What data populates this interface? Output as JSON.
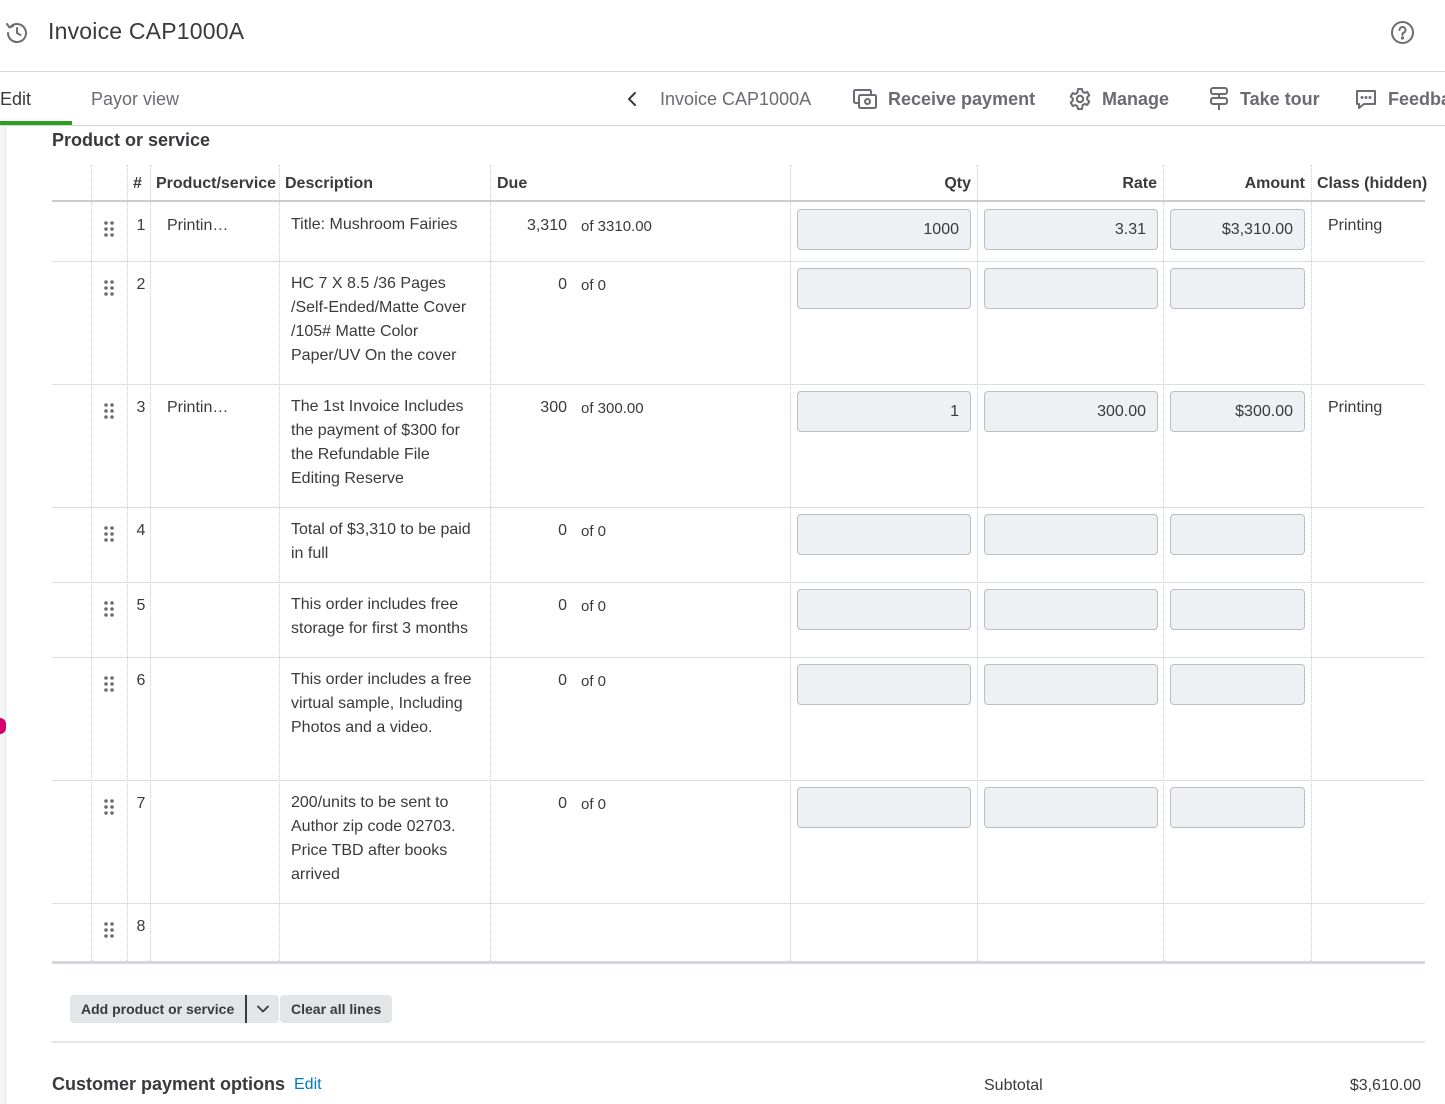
{
  "header": {
    "title": "Invoice CAP1000A",
    "history_icon": "history-icon",
    "help_icon": "help-icon"
  },
  "tabs": [
    {
      "label": "Edit",
      "active": true
    },
    {
      "label": "Payor view",
      "active": false
    }
  ],
  "nav": {
    "back_icon": "chevron-left-icon",
    "title": "Invoice CAP1000A"
  },
  "actions": [
    {
      "label": "Receive payment",
      "icon": "receive-payment-icon"
    },
    {
      "label": "Manage",
      "icon": "gear-icon"
    },
    {
      "label": "Take tour",
      "icon": "tour-icon"
    },
    {
      "label": "Feedback",
      "icon": "feedback-icon"
    }
  ],
  "section": {
    "title": "Product or service"
  },
  "table": {
    "columns": [
      "#",
      "Product/service",
      "Description",
      "Due",
      "Qty",
      "Rate",
      "Amount",
      "Class (hidden)"
    ],
    "rows": [
      {
        "num": "1",
        "product": "Printin…",
        "description": "Title: Mushroom Fairies",
        "due": "3,310",
        "due_of": "of 3310.00",
        "qty": "1000",
        "rate": "3.31",
        "amount": "$3,310.00",
        "class": "Printing"
      },
      {
        "num": "2",
        "product": "",
        "description": "HC 7 X 8.5 /36 Pages /Self-Ended/Matte Cover /105#  Matte Color Paper/UV On the cover",
        "due": "0",
        "due_of": "of 0",
        "qty": "",
        "rate": "",
        "amount": "",
        "class": ""
      },
      {
        "num": "3",
        "product": "Printin…",
        "description": "The 1st Invoice Includes the payment of $300 for the Refundable File Editing Reserve",
        "due": "300",
        "due_of": "of 300.00",
        "qty": "1",
        "rate": "300.00",
        "amount": "$300.00",
        "class": "Printing"
      },
      {
        "num": "4",
        "product": "",
        "description": "Total of $3,310 to be paid in full",
        "due": "0",
        "due_of": "of 0",
        "qty": "",
        "rate": "",
        "amount": "",
        "class": ""
      },
      {
        "num": "5",
        "product": "",
        "description": "This order includes free storage for first 3 months",
        "due": "0",
        "due_of": "of 0",
        "qty": "",
        "rate": "",
        "amount": "",
        "class": ""
      },
      {
        "num": "6",
        "product": "",
        "description": "This order includes a free virtual sample, Including Photos and a video.",
        "due": "0",
        "due_of": "of 0",
        "qty": "",
        "rate": "",
        "amount": "",
        "class": ""
      },
      {
        "num": "7",
        "product": "",
        "description": "200/units to be sent to Author zip code 02703. Price TBD after books arrived",
        "due": "0",
        "due_of": "of 0",
        "qty": "",
        "rate": "",
        "amount": "",
        "class": ""
      },
      {
        "num": "8",
        "product": "",
        "description": "",
        "due": "",
        "due_of": "",
        "qty": "",
        "rate": "",
        "amount": "",
        "class": ""
      }
    ]
  },
  "buttons": {
    "add_line": "Add product or service",
    "add_line_caret_icon": "chevron-down-icon",
    "clear_lines": "Clear all lines"
  },
  "payment_options": {
    "title": "Customer payment options",
    "edit_link": "Edit"
  },
  "totals": {
    "subtotal_label": "Subtotal",
    "subtotal_value": "$3,610.00"
  },
  "colors": {
    "active_tab": "#2ca01c",
    "link": "#0077c5",
    "marker": "#d5006d"
  }
}
